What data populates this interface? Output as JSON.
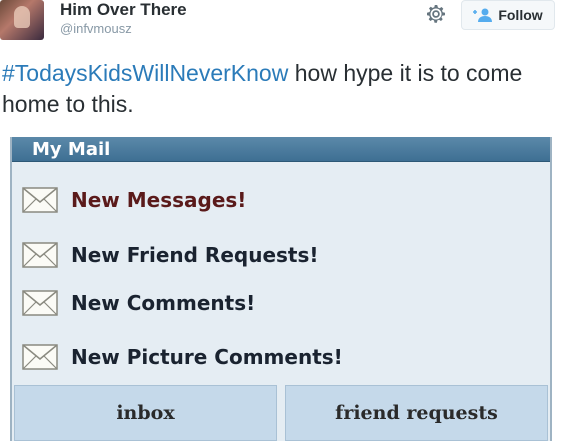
{
  "tweet": {
    "display_name": "Him Over There",
    "handle": "@infvmousz",
    "follow_label": "Follow",
    "hashtag": "#TodaysKidsWillNeverKnow",
    "text": " how hype it is to come home to this."
  },
  "mail_widget": {
    "title": "My Mail",
    "items": [
      {
        "label": "New Messages!",
        "color": "#5a1a1a"
      },
      {
        "label": "New Friend Requests!",
        "color": "#1a2330"
      },
      {
        "label": "New Comments!",
        "color": "#1a2330"
      },
      {
        "label": "New Picture Comments!",
        "color": "#1a2330"
      }
    ],
    "buttons": [
      "inbox",
      "friend requests"
    ]
  },
  "colors": {
    "hashtag": "#2b7bb9",
    "mail_header": "#4a7ba0",
    "mail_body": "#e5edf3",
    "mail_button": "#c5d9ea"
  }
}
